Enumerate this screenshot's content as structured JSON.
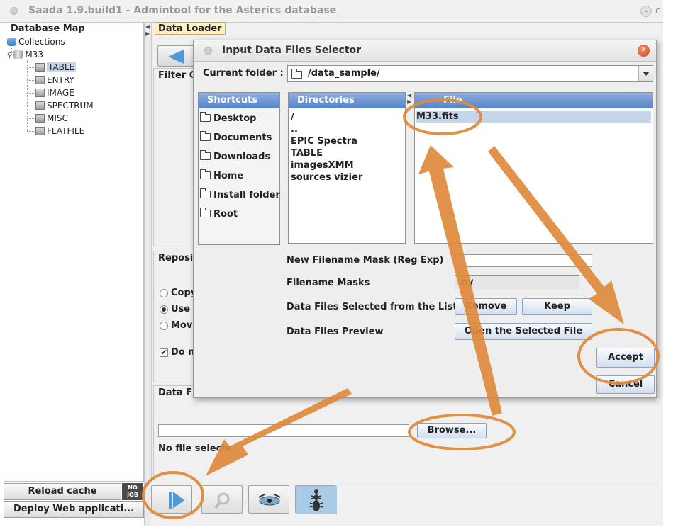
{
  "window": {
    "title": "Saada 1.9.build1 - Admintool for the Asterics database"
  },
  "sidebar": {
    "title": "Database Map",
    "root": "Collections",
    "collection": "M33",
    "categories": [
      "TABLE",
      "ENTRY",
      "IMAGE",
      "SPECTRUM",
      "MISC",
      "FLATFILE"
    ],
    "selected": "TABLE",
    "reload_label": "Reload cache",
    "deploy_label": "Deploy Web applicati...",
    "nojob_label": "NO JOB"
  },
  "loader": {
    "tab_label": "Data Loader",
    "filter_title": "Filter C",
    "repository_title": "Reposit",
    "radio_copy": "Copy",
    "radio_use": "Use",
    "radio_move": "Move",
    "checkbox_label": "Do n",
    "datafile_title": "Data Fi",
    "browse_label": "Browse...",
    "no_file_label": "No file selecte"
  },
  "dialog": {
    "title": "Input Data Files Selector",
    "current_folder_label": "Current folder :",
    "current_folder_value": "/data_sample/",
    "shortcuts_header": "Shortcuts",
    "shortcuts": [
      "Desktop",
      "Documents",
      "Downloads",
      "Home",
      "Install folder",
      "Root"
    ],
    "directories_header": "Directories",
    "directories": [
      "/",
      "..",
      "EPIC Spectra",
      "TABLE",
      "imagesXMM",
      "sources vizier"
    ],
    "files_header": "File",
    "files": [
      "M33.fits"
    ],
    "mask_label": "New Filename Mask (Reg Exp)",
    "masks_label": "Filename Masks",
    "masks_value": "ny",
    "selected_label": "Data Files Selected from the List",
    "remove_label": "Remove",
    "keep_label": "Keep",
    "preview_label": "Data Files Preview",
    "open_label": "Open the Selected File",
    "accept_label": "Accept",
    "cancel_label": "Cancel"
  },
  "colors": {
    "annotation": "#e08a3c",
    "header_blue": "#5682c6",
    "tab_bg": "#ffefc2"
  }
}
